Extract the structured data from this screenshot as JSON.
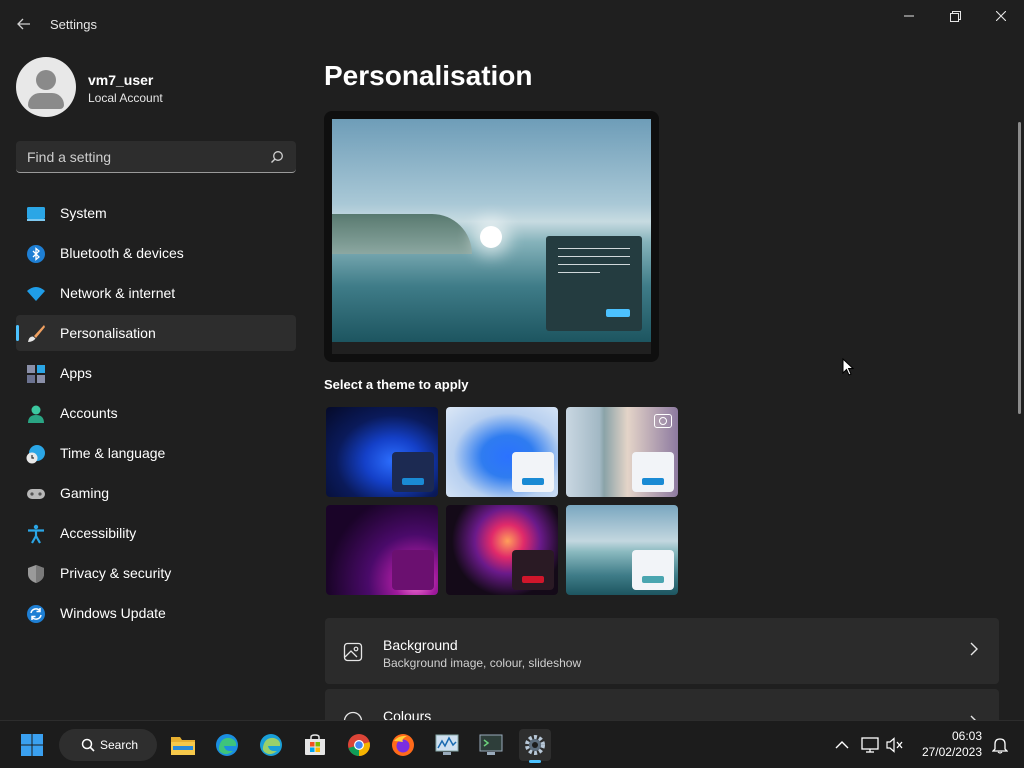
{
  "window": {
    "title": "Settings",
    "back_icon": "arrow-left-icon",
    "controls": [
      "minimize-icon",
      "maximize-icon",
      "close-icon"
    ]
  },
  "profile": {
    "name": "vm7_user",
    "account_type": "Local Account"
  },
  "search": {
    "placeholder": "Find a setting"
  },
  "sidebar": {
    "items": [
      {
        "label": "System",
        "icon": "system-icon",
        "selected": false
      },
      {
        "label": "Bluetooth & devices",
        "icon": "bluetooth-icon",
        "selected": false
      },
      {
        "label": "Network & internet",
        "icon": "wifi-icon",
        "selected": false
      },
      {
        "label": "Personalisation",
        "icon": "paintbrush-icon",
        "selected": true
      },
      {
        "label": "Apps",
        "icon": "apps-icon",
        "selected": false
      },
      {
        "label": "Accounts",
        "icon": "accounts-icon",
        "selected": false
      },
      {
        "label": "Time & language",
        "icon": "clock-globe-icon",
        "selected": false
      },
      {
        "label": "Gaming",
        "icon": "gamepad-icon",
        "selected": false
      },
      {
        "label": "Accessibility",
        "icon": "accessibility-icon",
        "selected": false
      },
      {
        "label": "Privacy & security",
        "icon": "shield-icon",
        "selected": false
      },
      {
        "label": "Windows Update",
        "icon": "update-icon",
        "selected": false
      }
    ]
  },
  "main": {
    "title": "Personalisation",
    "theme_section_label": "Select a theme to apply",
    "themes": [
      {
        "name": "windows-dark-theme",
        "accent": "#1a8ad4"
      },
      {
        "name": "windows-light-theme",
        "accent": "#1a8ad4"
      },
      {
        "name": "windows-spotlight-theme",
        "accent": "#1a8ad4"
      },
      {
        "name": "glow-theme",
        "accent": "#6b1070"
      },
      {
        "name": "captured-motion-theme",
        "accent": "#d0162b"
      },
      {
        "name": "flow-theme",
        "accent": "#4aa5b0"
      }
    ],
    "cards": [
      {
        "title": "Background",
        "subtitle": "Background image, colour, slideshow",
        "icon": "image-icon"
      },
      {
        "title": "Colours",
        "subtitle": "",
        "icon": "palette-icon"
      }
    ]
  },
  "taskbar": {
    "search_label": "Search",
    "apps": [
      "start-icon",
      "file-explorer-icon",
      "edge-icon",
      "edge-beta-icon",
      "store-icon",
      "chrome-icon",
      "firefox-icon",
      "performance-monitor-icon",
      "terminal-icon",
      "settings-icon"
    ],
    "time": "06:03",
    "date": "27/02/2023"
  },
  "colors": {
    "accent": "#4cc2ff",
    "background": "#1f1f1f",
    "card": "#2b2b2b"
  }
}
